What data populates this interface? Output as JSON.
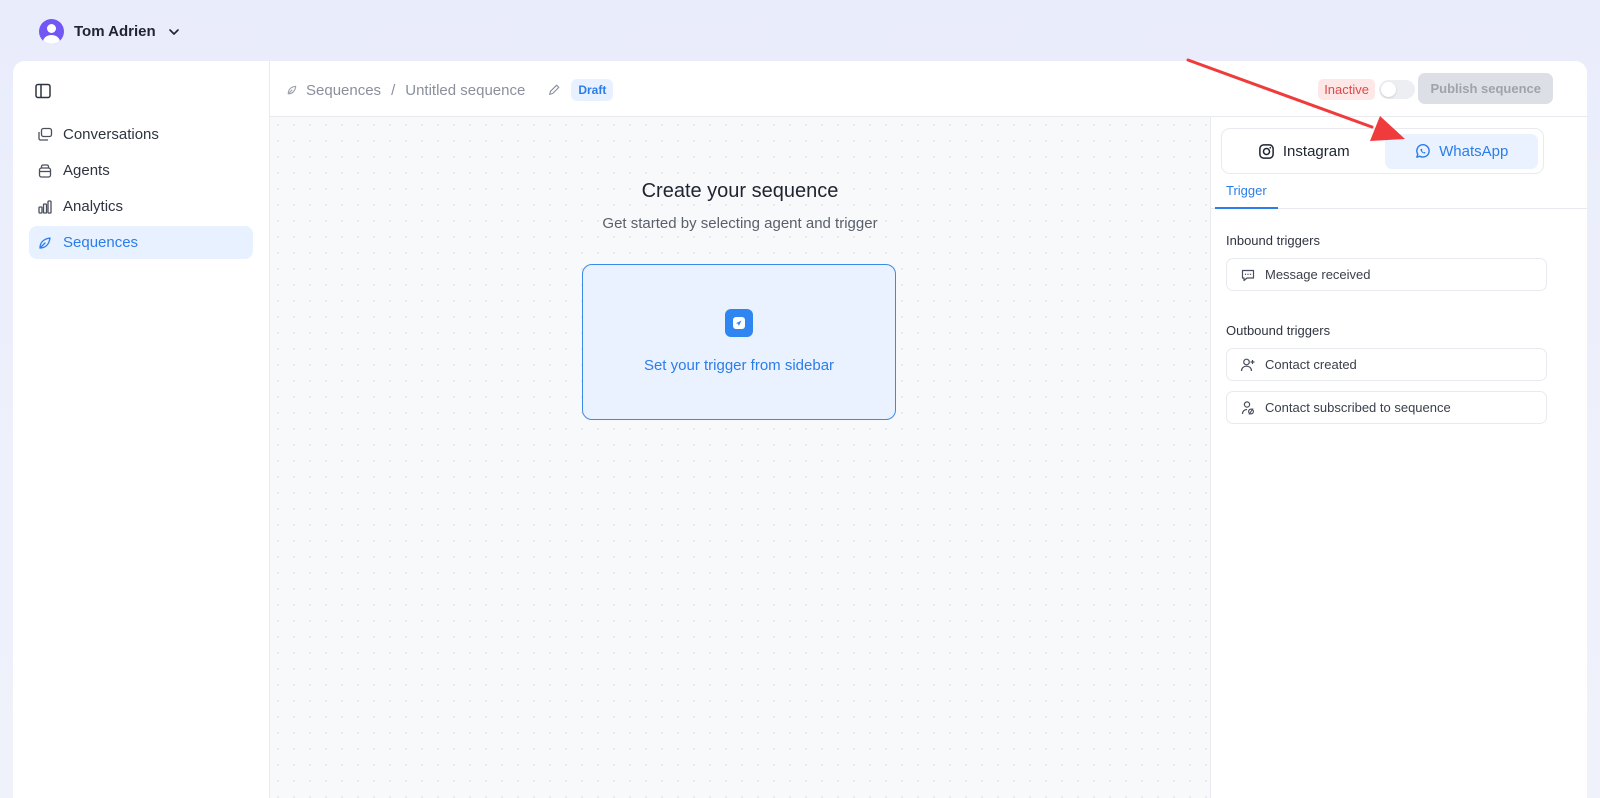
{
  "user": {
    "name": "Tom Adrien"
  },
  "sidebar": {
    "items": [
      {
        "label": "Conversations",
        "icon": "chat-bubbles-icon",
        "active": false
      },
      {
        "label": "Agents",
        "icon": "agent-icon",
        "active": false
      },
      {
        "label": "Analytics",
        "icon": "bar-chart-icon",
        "active": false
      },
      {
        "label": "Sequences",
        "icon": "sequence-icon",
        "active": true
      }
    ]
  },
  "header": {
    "breadcrumb": [
      "Sequences",
      "Untitled sequence"
    ],
    "status_badge": "Draft",
    "state_badge": "Inactive",
    "publish_label": "Publish sequence"
  },
  "canvas": {
    "title": "Create your sequence",
    "subtitle": "Get started by selecting agent and trigger",
    "trigger_card_text": "Set your trigger from sidebar"
  },
  "panel": {
    "channels": [
      {
        "label": "Instagram",
        "icon": "instagram-icon",
        "active": false
      },
      {
        "label": "WhatsApp",
        "icon": "whatsapp-icon",
        "active": true
      }
    ],
    "tab": "Trigger",
    "inbound_label": "Inbound triggers",
    "inbound": [
      {
        "label": "Message received",
        "icon": "message-icon"
      }
    ],
    "outbound_label": "Outbound triggers",
    "outbound": [
      {
        "label": "Contact created",
        "icon": "user-plus-icon"
      },
      {
        "label": "Contact subscribed to sequence",
        "icon": "user-subscribe-icon"
      }
    ]
  },
  "colors": {
    "accent": "#2b7de9",
    "arrow": "#ef3b3b",
    "inactive": "#e04848"
  }
}
